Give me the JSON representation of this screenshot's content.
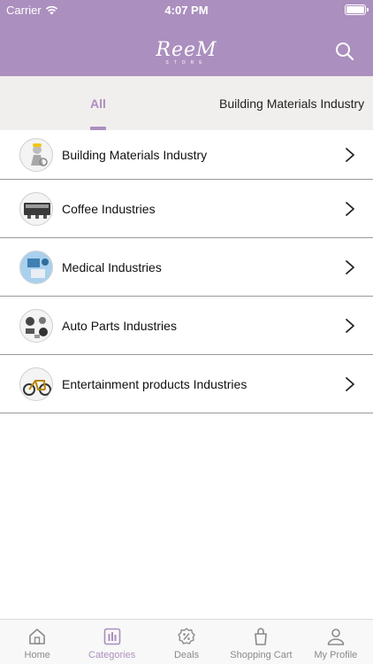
{
  "status_bar": {
    "carrier": "Carrier",
    "time": "4:07 PM"
  },
  "header": {
    "logo": "ReeM",
    "logo_sub": "STORE"
  },
  "tabs": [
    {
      "label": "All",
      "selected": true
    },
    {
      "label": "Building Materials Industry",
      "selected": false
    }
  ],
  "categories": [
    {
      "label": "Building Materials Industry",
      "icon": "worker-figure-icon"
    },
    {
      "label": "Coffee Industries",
      "icon": "espresso-machine-icon"
    },
    {
      "label": "Medical Industries",
      "icon": "medical-equipment-icon"
    },
    {
      "label": "Auto Parts Industries",
      "icon": "auto-parts-icon"
    },
    {
      "label": "Entertainment products Industries",
      "icon": "bicycle-icon"
    }
  ],
  "tab_bar": [
    {
      "label": "Home",
      "icon": "home-icon",
      "active": false
    },
    {
      "label": "Categories",
      "icon": "categories-icon",
      "active": true
    },
    {
      "label": "Deals",
      "icon": "deals-icon",
      "active": false
    },
    {
      "label": "Shopping Cart",
      "icon": "shopping-cart-icon",
      "active": false
    },
    {
      "label": "My Profile",
      "icon": "profile-icon",
      "active": false
    }
  ],
  "colors": {
    "accent": "#ab8fbe",
    "tab_background": "#f1eeee",
    "divider": "#9a9a9a"
  }
}
